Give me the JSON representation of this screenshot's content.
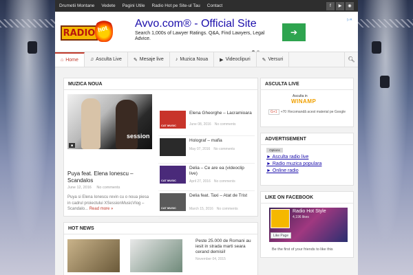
{
  "topnav": [
    "Drumetii Montane",
    "Vedete",
    "Pagini Utile",
    "Radio Hot pe Site-ul Tau",
    "Contact"
  ],
  "social": [
    {
      "icon": "facebook-icon",
      "glyph": "f"
    },
    {
      "icon": "youtube-icon",
      "glyph": "▶"
    },
    {
      "icon": "rss-icon",
      "glyph": "◉"
    }
  ],
  "logo": {
    "text": "RADIO",
    "flame_text": "hot"
  },
  "ad": {
    "title": "Avvo.com® - Official Site",
    "desc": "Search 1,000s of Lawyer Ratings. Q&A, Find Lawyers, Legal Advice.",
    "button_glyph": "➔",
    "adchoices": "▷✕"
  },
  "mainnav": [
    {
      "label": "Home",
      "icon": "home-icon",
      "glyph": "⌂"
    },
    {
      "label": "Asculta Live",
      "icon": "headphones-icon",
      "glyph": "♫"
    },
    {
      "label": "Mesaje live",
      "icon": "pencil-icon",
      "glyph": "✎"
    },
    {
      "label": "Muzica Noua",
      "icon": "music-icon",
      "glyph": "♪"
    },
    {
      "label": "Videoclipuri",
      "icon": "video-icon",
      "glyph": "▶"
    },
    {
      "label": "Versuri",
      "icon": "pencil-icon",
      "glyph": "✎"
    }
  ],
  "muzica": {
    "heading": "MUZICA NOUA",
    "feature": {
      "watermark": "session",
      "title": "Puya feat. Elena Ionescu – Scandalos",
      "date": "June 12, 2016",
      "comments": "No comments",
      "excerpt": "Puya si Elena Ionescu revin cu o noua piesa in cadrul proiectului XSessionMusicVlog – Scandalo...",
      "more": "Read more »"
    },
    "list": [
      {
        "title": "Elena Gheorghe – Lacramioara",
        "date": "June 08, 2016",
        "comments": "No comments",
        "tag": "CAT MUSIC",
        "color": "#c8342a"
      },
      {
        "title": "Holograf – mafia",
        "date": "May 07, 2016",
        "comments": "No comments",
        "tag": "",
        "color": "#2a2a2a"
      },
      {
        "title": "Delia – Ce are ea (videoclip live)",
        "date": "April 27, 2016",
        "comments": "No comments",
        "tag": "CAT MUSIC",
        "color": "#4a2a7a"
      },
      {
        "title": "Delia feat. Taxi – Atat de Trist",
        "date": "March 15, 2016",
        "comments": "No comments",
        "tag": "CAT MUSIC",
        "color": "#5a5a5a"
      }
    ]
  },
  "hot": {
    "heading": "HOT NEWS",
    "title": "Peste 25.000 de Romani au iesit in strada marti seara cerand demisii!",
    "date": "November 04, 2015"
  },
  "sidebar": {
    "asculta": {
      "heading": "ASCULTA LIVE",
      "label": "Asculta in",
      "logo": "WINAMP",
      "gplus": "G+1",
      "count": "+70",
      "gtext": "Recomandă acest material pe Google"
    },
    "advert": {
      "heading": "ADVERTISEMENT",
      "options": "Options",
      "links": [
        "► Asculta radio live",
        "► Radio muzica populara",
        "► Online radio"
      ]
    },
    "facebook": {
      "heading": "LIKE ON FACEBOOK",
      "page": "Radio Hot Style",
      "likes": "4,196 likes",
      "like_btn": "Like Page",
      "friends": "Be the first of your friends to like this"
    }
  }
}
